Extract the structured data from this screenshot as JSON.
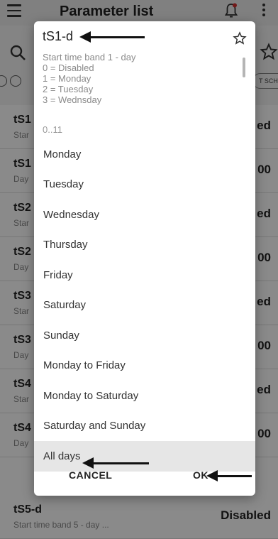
{
  "app_bar": {
    "title": "Parameter list"
  },
  "toolbar": {
    "filter_chip": "T SCHE"
  },
  "rows": [
    {
      "code": "tS1",
      "desc": "Star",
      "value": "ed"
    },
    {
      "code": "tS1",
      "desc": "Day",
      "value": "00"
    },
    {
      "code": "tS2",
      "desc": "Star",
      "value": "ed"
    },
    {
      "code": "tS2",
      "desc": "Day",
      "value": "00"
    },
    {
      "code": "tS3",
      "desc": "Star",
      "value": "ed"
    },
    {
      "code": "tS3",
      "desc": "Day",
      "value": "00"
    },
    {
      "code": "tS4",
      "desc": "Star",
      "value": "ed"
    },
    {
      "code": "tS4",
      "desc": "Day",
      "value": "00"
    }
  ],
  "last_row": {
    "code": "tS5-d",
    "desc": "Start time band 5 - day ...",
    "value": "Disabled"
  },
  "dialog": {
    "title": "tS1-d",
    "description": [
      "Start time band 1 - day",
      "0 = Disabled",
      "1 = Monday",
      "2 = Tuesday",
      "3 = Wednsday"
    ],
    "range": "0..11",
    "options": [
      "Monday",
      "Tuesday",
      "Wednesday",
      "Thursday",
      "Friday",
      "Saturday",
      "Sunday",
      "Monday to Friday",
      "Monday to Saturday",
      "Saturday and Sunday",
      "All days"
    ],
    "selected_option": "All days",
    "cancel_label": "CANCEL",
    "ok_label": "OK"
  },
  "colors": {
    "annotation_arrow": "#111111",
    "scrim": "#000000",
    "selected_option_bg": "#e6e6e6"
  },
  "icons": [
    "menu-icon",
    "bell-icon",
    "more-vert-icon",
    "search-icon",
    "star-outline-icon"
  ]
}
